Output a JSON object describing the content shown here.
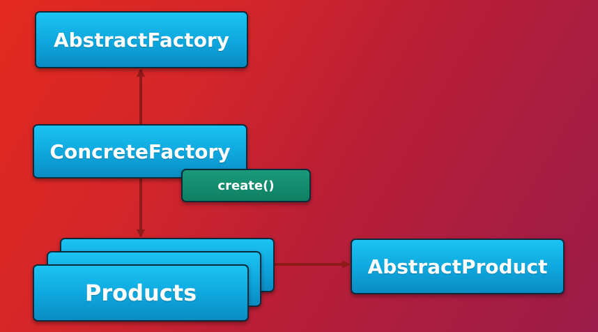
{
  "diagram": {
    "abstract_factory": "AbstractFactory",
    "concrete_factory": "ConcreteFactory",
    "create_method": "create()",
    "products": "Products",
    "abstract_product": "AbstractProduct"
  },
  "colors": {
    "background_start": "#e32a1f",
    "background_end": "#9a1c48",
    "box_fill": "#0ea6dd",
    "method_fill": "#0f7e62",
    "connector": "#8f1a1a"
  }
}
